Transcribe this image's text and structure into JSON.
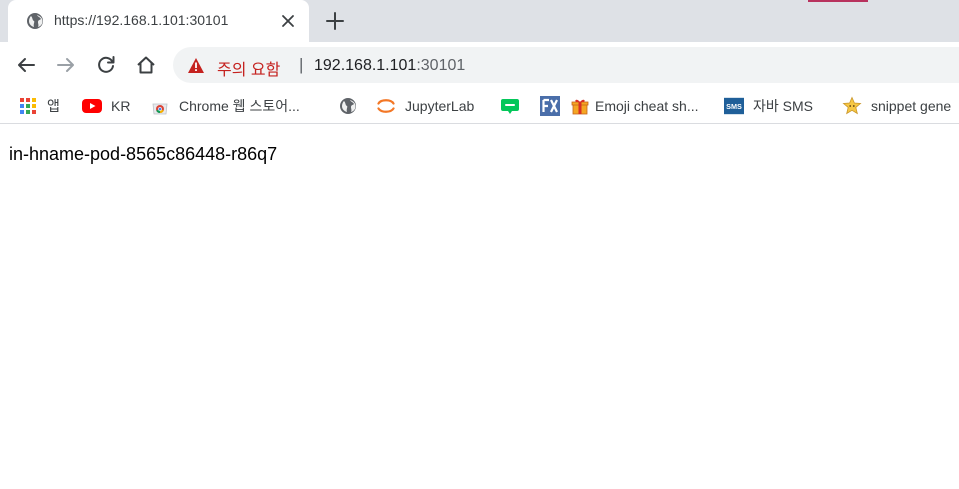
{
  "tab": {
    "title": "https://192.168.1.101:30101",
    "close_icon": "close-icon",
    "favicon": "globe-icon"
  },
  "new_tab_icon": "plus-icon",
  "toolbar": {
    "back_icon": "arrow-left-icon",
    "forward_icon": "arrow-right-icon",
    "reload_icon": "reload-icon",
    "home_icon": "home-icon"
  },
  "omnibox": {
    "security_label": "주의 요함",
    "separator": "|",
    "url_host": "192.168.1.101",
    "url_port": ":30101",
    "warning_icon": "warning-triangle-icon"
  },
  "bookmarks": [
    {
      "label": "앱",
      "icon": "apps-grid-icon"
    },
    {
      "label": "KR",
      "icon": "youtube-icon"
    },
    {
      "label": "Chrome 웹 스토어...",
      "icon": "chrome-webstore-icon"
    },
    {
      "label": "",
      "icon": "globe-icon"
    },
    {
      "label": "JupyterLab",
      "icon": "jupyter-icon"
    },
    {
      "label": "",
      "icon": "blog-icon"
    },
    {
      "label": "",
      "icon": "fx-icon"
    },
    {
      "label": "Emoji cheat sh...",
      "icon": "gift-icon"
    },
    {
      "label": "자바 SMS",
      "icon": "sms-icon"
    },
    {
      "label": "snippet gene",
      "icon": "star-face-icon"
    }
  ],
  "colors": {
    "warning": "#c5221f",
    "tabstrip": "#dee1e6",
    "omnibox": "#f1f3f4"
  },
  "page": {
    "text": "in-hname-pod-8565c86448-r86q7"
  }
}
